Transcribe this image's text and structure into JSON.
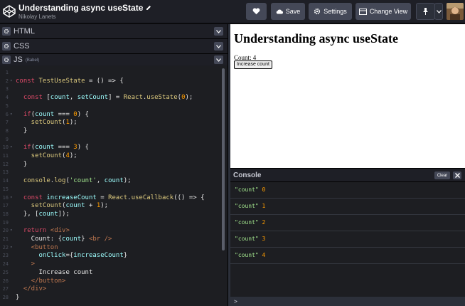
{
  "header": {
    "title": "Understanding async useState",
    "author": "Nikolay Lanets",
    "save_label": "Save",
    "settings_label": "Settings",
    "change_view_label": "Change View"
  },
  "editors": {
    "html_label": "HTML",
    "css_label": "CSS",
    "js_label": "JS",
    "js_sub": "(Babel)"
  },
  "code_lines": [
    {
      "n": "1",
      "t": []
    },
    {
      "n": "2",
      "f": true,
      "t": [
        [
          "k",
          "const "
        ],
        [
          "fn",
          "TestUseState"
        ],
        [
          "pl",
          " = () => {"
        ]
      ]
    },
    {
      "n": "3",
      "t": []
    },
    {
      "n": "4",
      "t": [
        [
          "k",
          "  const "
        ],
        [
          "pl",
          "["
        ],
        [
          "v",
          "count"
        ],
        [
          "pl",
          ", "
        ],
        [
          "v",
          "setCount"
        ],
        [
          "pl",
          "] = "
        ],
        [
          "fn",
          "React"
        ],
        [
          "pl",
          "."
        ],
        [
          "fn",
          "useState"
        ],
        [
          "pl",
          "("
        ],
        [
          "n",
          "0"
        ],
        [
          "pl",
          ");"
        ]
      ]
    },
    {
      "n": "5",
      "t": []
    },
    {
      "n": "6",
      "f": true,
      "t": [
        [
          "k",
          "  if"
        ],
        [
          "pl",
          "("
        ],
        [
          "v",
          "count"
        ],
        [
          "pl",
          " === "
        ],
        [
          "n",
          "0"
        ],
        [
          "pl",
          ") {"
        ]
      ]
    },
    {
      "n": "7",
      "t": [
        [
          "fb",
          "    setCount"
        ],
        [
          "pl",
          "("
        ],
        [
          "n",
          "1"
        ],
        [
          "pl",
          ");"
        ]
      ]
    },
    {
      "n": "8",
      "t": [
        [
          "pl",
          "  }"
        ]
      ]
    },
    {
      "n": "9",
      "t": []
    },
    {
      "n": "10",
      "f": true,
      "t": [
        [
          "k",
          "  if"
        ],
        [
          "pl",
          "("
        ],
        [
          "v",
          "count"
        ],
        [
          "pl",
          " === "
        ],
        [
          "n",
          "3"
        ],
        [
          "pl",
          ") {"
        ]
      ]
    },
    {
      "n": "11",
      "t": [
        [
          "fb",
          "    setCount"
        ],
        [
          "pl",
          "("
        ],
        [
          "n",
          "4"
        ],
        [
          "pl",
          ");"
        ]
      ]
    },
    {
      "n": "12",
      "t": [
        [
          "pl",
          "  }"
        ]
      ]
    },
    {
      "n": "13",
      "t": []
    },
    {
      "n": "14",
      "t": [
        [
          "fn",
          "  console"
        ],
        [
          "pl",
          "."
        ],
        [
          "fn",
          "log"
        ],
        [
          "pl",
          "("
        ],
        [
          "s",
          "'count'"
        ],
        [
          "pl",
          ", "
        ],
        [
          "v",
          "count"
        ],
        [
          "pl",
          ");"
        ]
      ]
    },
    {
      "n": "15",
      "t": []
    },
    {
      "n": "16",
      "f": true,
      "t": [
        [
          "k",
          "  const "
        ],
        [
          "v",
          "increaseCount"
        ],
        [
          "pl",
          " = "
        ],
        [
          "fn",
          "React"
        ],
        [
          "pl",
          "."
        ],
        [
          "fn",
          "useCallback"
        ],
        [
          "pl",
          "(() => {"
        ]
      ]
    },
    {
      "n": "17",
      "t": [
        [
          "fb",
          "    setCount"
        ],
        [
          "pl",
          "("
        ],
        [
          "v",
          "count"
        ],
        [
          "pl",
          " + "
        ],
        [
          "n",
          "1"
        ],
        [
          "pl",
          ");"
        ]
      ]
    },
    {
      "n": "18",
      "t": [
        [
          "pl",
          "  }, ["
        ],
        [
          "v",
          "count"
        ],
        [
          "pl",
          "]);"
        ]
      ]
    },
    {
      "n": "19",
      "t": []
    },
    {
      "n": "20",
      "f": true,
      "t": [
        [
          "k",
          "  return "
        ],
        [
          "tg",
          "<div>"
        ]
      ]
    },
    {
      "n": "21",
      "t": [
        [
          "pl",
          "    Count: {"
        ],
        [
          "v",
          "count"
        ],
        [
          "pl",
          "} "
        ],
        [
          "tg",
          "<br />"
        ]
      ]
    },
    {
      "n": "22",
      "f": true,
      "t": [
        [
          "tg",
          "    <button"
        ]
      ]
    },
    {
      "n": "23",
      "t": [
        [
          "at",
          "      onClick"
        ],
        [
          "pl",
          "={"
        ],
        [
          "v",
          "increaseCount"
        ],
        [
          "pl",
          "}"
        ]
      ]
    },
    {
      "n": "24",
      "t": [
        [
          "tg",
          "    >"
        ]
      ]
    },
    {
      "n": "25",
      "t": [
        [
          "pl",
          "      Increase count"
        ]
      ]
    },
    {
      "n": "26",
      "t": [
        [
          "tg",
          "    </button>"
        ]
      ]
    },
    {
      "n": "27",
      "t": [
        [
          "tg",
          "  </div>"
        ]
      ]
    },
    {
      "n": "28",
      "t": [
        [
          "pl",
          "}"
        ]
      ]
    }
  ],
  "preview": {
    "heading": "Understanding async useState",
    "count_text": "Count: 4",
    "button_label": "Increase count"
  },
  "console": {
    "title": "Console",
    "clear_label": "Clear",
    "prompt": ">",
    "entries": [
      {
        "label": "\"count\"",
        "value": "0"
      },
      {
        "label": "\"count\"",
        "value": "1"
      },
      {
        "label": "\"count\"",
        "value": "2"
      },
      {
        "label": "\"count\"",
        "value": "3"
      },
      {
        "label": "\"count\"",
        "value": "4"
      }
    ]
  },
  "icons": {
    "logo": "codepen-logo-icon",
    "edit": "pencil-icon",
    "heart": "heart-icon",
    "save": "cloud-icon",
    "settings": "gear-icon",
    "change_view": "layout-icon",
    "pin": "pin-icon",
    "chevron": "chevron-down-icon",
    "close": "close-icon"
  },
  "colors": {
    "header_bg": "#1e1f26",
    "editor_bg": "#1d1e22",
    "button_bg": "#444857",
    "keyword": "#dd4a68",
    "string": "#a3e68e",
    "number": "#ff9d00",
    "variable": "#9effff",
    "function": "#ddca7e"
  }
}
